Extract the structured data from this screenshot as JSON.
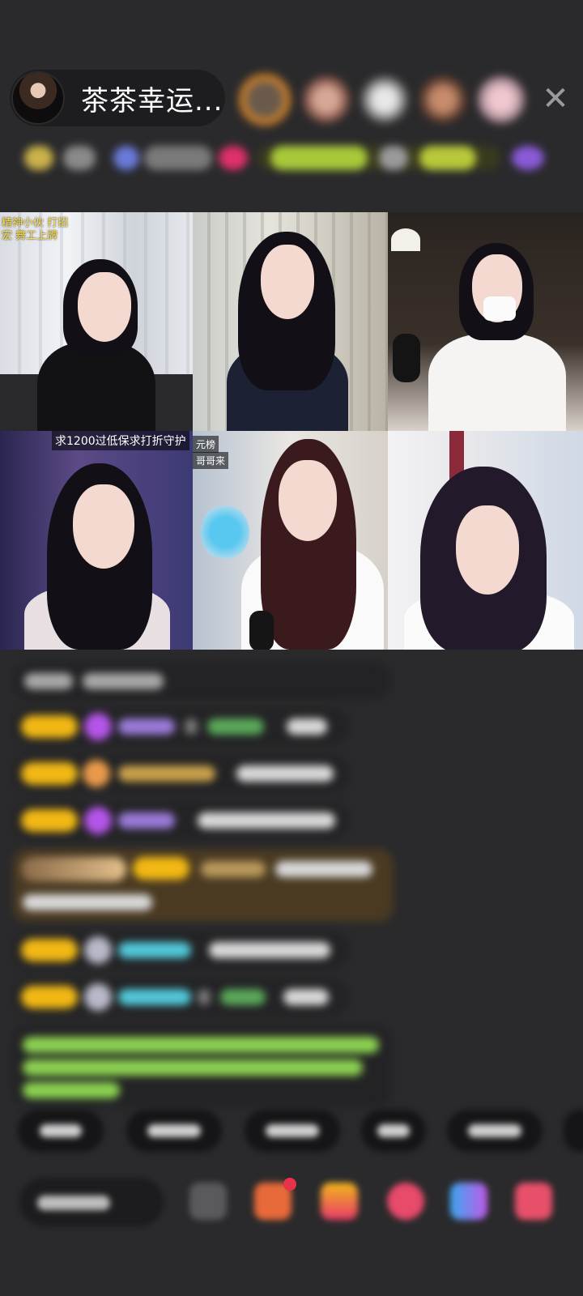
{
  "header": {
    "host_name": "茶茶幸运...",
    "close_icon": "close-icon"
  },
  "grid": {
    "tile1_caption_line1": "精神小伙 打招",
    "tile1_caption_line2": "宏  舞工上牌",
    "tile4_caption": "求1200过低保求打折守护",
    "tile5_caption_line1": "元榜",
    "tile5_caption_line2": "哥哥来"
  },
  "colors": {
    "background": "#2a2a2c",
    "level_badge": "#f1b814",
    "diamond": "#b455e8",
    "highlight_message": "#4a3a22",
    "green_text": "#8bd250",
    "cyan_name": "#52c7d8"
  }
}
